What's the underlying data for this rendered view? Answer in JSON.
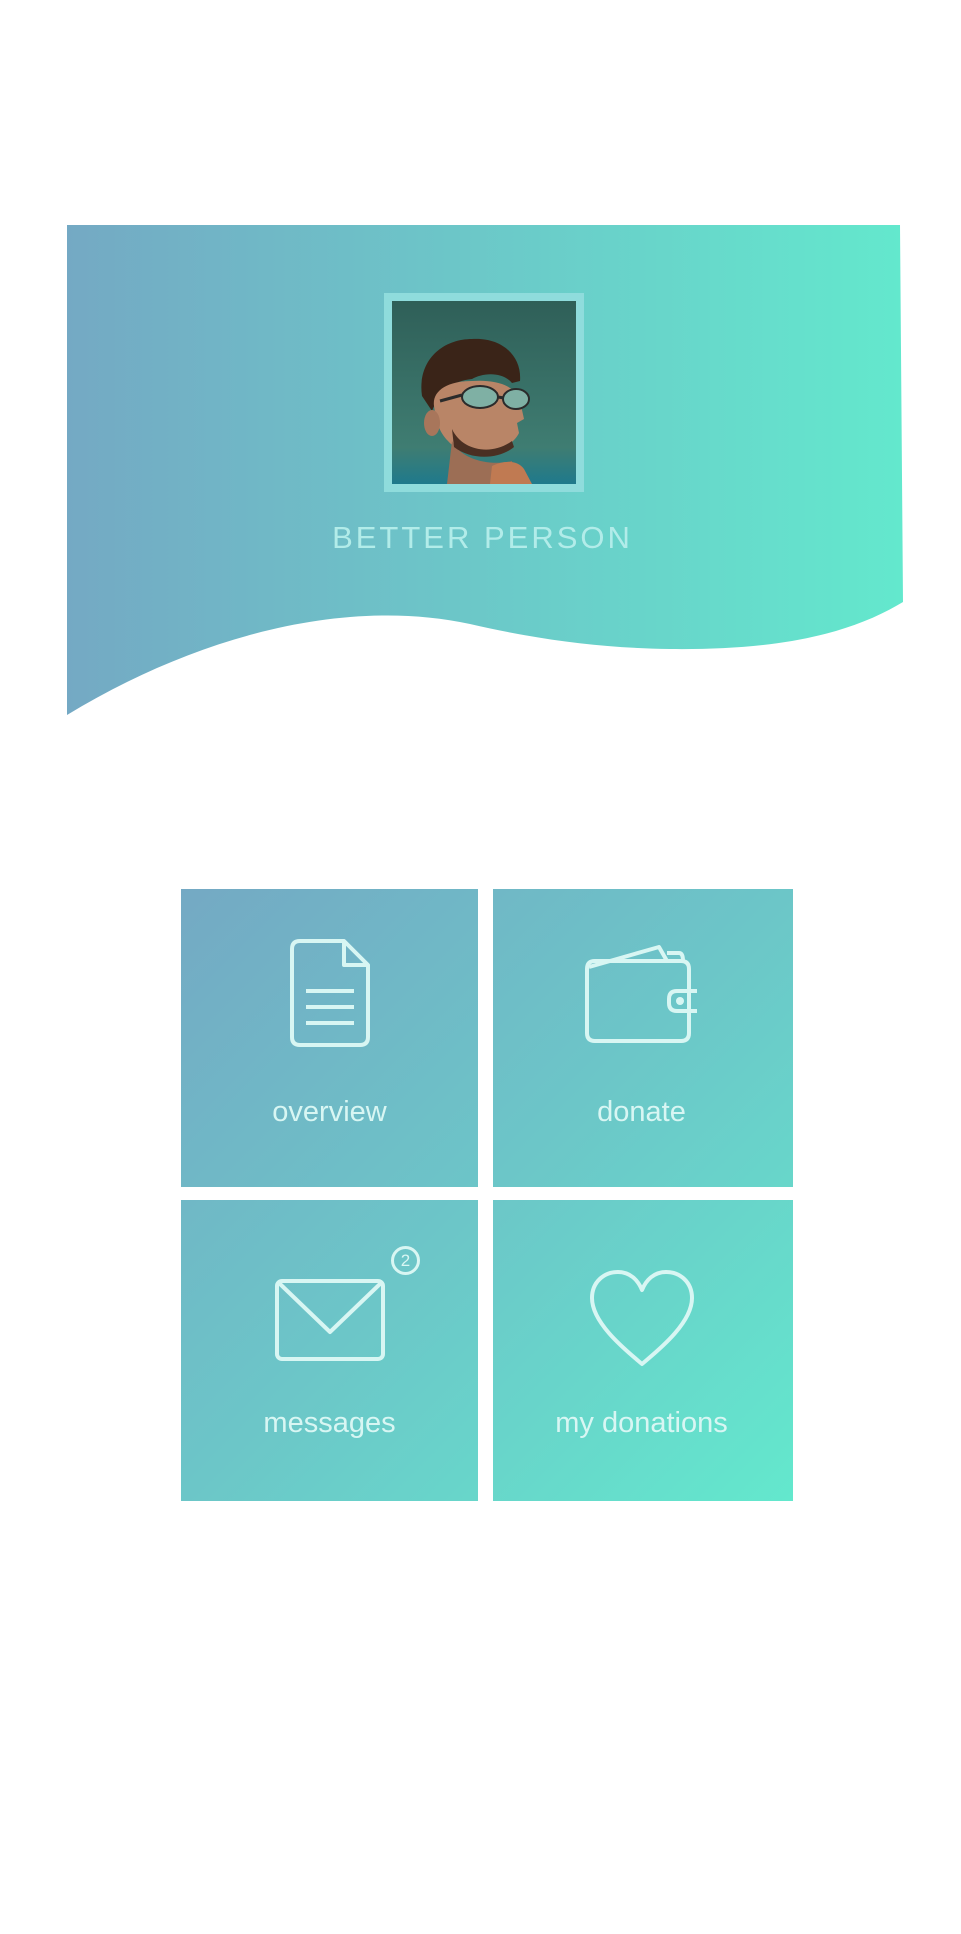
{
  "profile": {
    "name": "BETTER PERSON",
    "avatar_icon": "profile-photo"
  },
  "colors": {
    "gradient_start": "#74a9c4",
    "gradient_end": "#63e8cd",
    "tile_text": "#d8f6f3",
    "name_text": "#b2ece9"
  },
  "menu": {
    "tiles": [
      {
        "label": "overview",
        "icon": "document-icon"
      },
      {
        "label": "donate",
        "icon": "wallet-icon"
      },
      {
        "label": "messages",
        "icon": "envelope-icon",
        "badge": "2"
      },
      {
        "label": "my donations",
        "icon": "heart-icon"
      }
    ]
  }
}
